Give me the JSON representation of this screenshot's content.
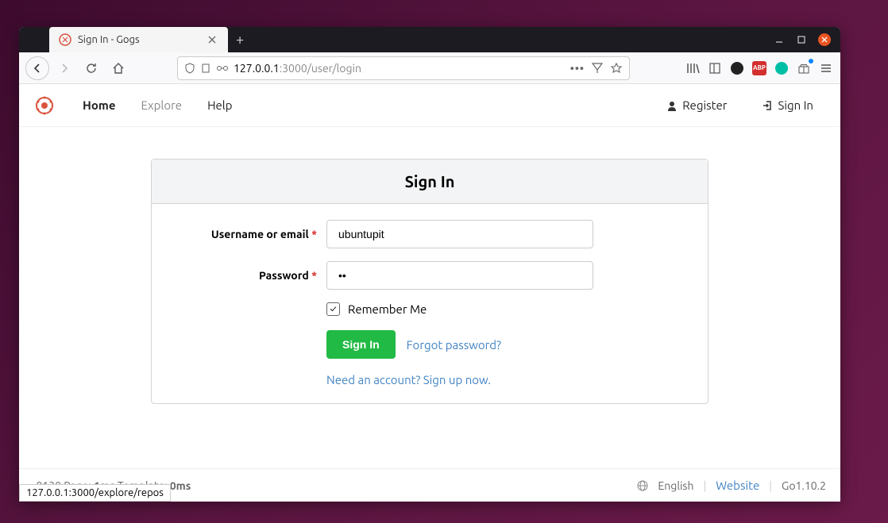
{
  "window": {
    "tab_title": "Sign In - Gogs"
  },
  "address": {
    "host": "127.0.0.1",
    "path": ":3000/user/login"
  },
  "nav": {
    "home": "Home",
    "explore": "Explore",
    "help": "Help",
    "register": "Register",
    "signin": "Sign In"
  },
  "form": {
    "title": "Sign In",
    "username_label": "Username or email",
    "username_value": "ubuntupit",
    "password_label": "Password",
    "password_value": "••",
    "remember": "Remember Me",
    "signin_btn": "Sign In",
    "forgot": "Forgot password?",
    "signup": "Need an account? Sign up now."
  },
  "footer": {
    "page_label": ".0130 Page: ",
    "page_time": "1ms",
    "template_label": " Template: ",
    "template_time": "0ms",
    "english": "English",
    "website": "Website",
    "go_version": "Go1.10.2"
  },
  "status_hover": "127.0.0.1:3000/explore/repos"
}
